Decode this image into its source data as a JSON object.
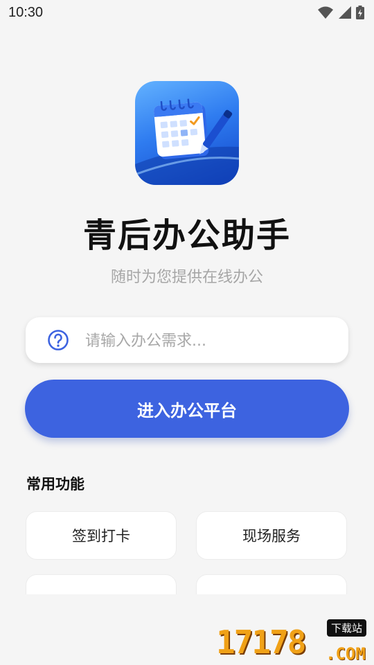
{
  "status_bar": {
    "time": "10:30"
  },
  "app": {
    "name": "青后办公助手",
    "tagline": "随时为您提供在线办公"
  },
  "search": {
    "placeholder": "请输入办公需求..."
  },
  "primary_action": {
    "label": "进入办公平台"
  },
  "functions": {
    "title": "常用功能",
    "items": [
      "签到打卡",
      "现场服务",
      "",
      ""
    ]
  },
  "watermark": {
    "digits": "17178",
    "suffix": ".COM",
    "badge": "下载站"
  },
  "colors": {
    "primary": "#3d63e0",
    "background": "#f5f5f5",
    "watermark": "#f0a117"
  }
}
